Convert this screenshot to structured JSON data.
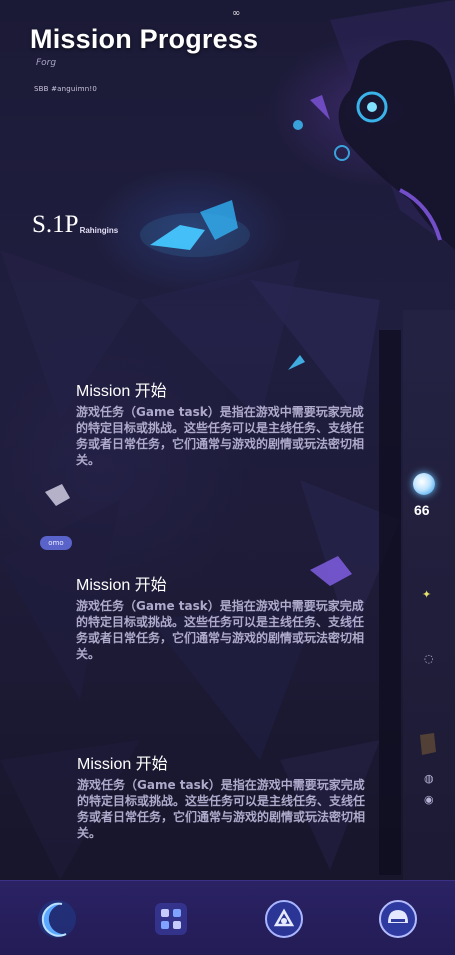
{
  "header": {
    "title": "Mission Progress",
    "top_marker": "∞",
    "subtitle": "Forg",
    "caption": "SBB #anguimn!0"
  },
  "stat": {
    "value": "S.1P",
    "unit": "Rahingins"
  },
  "chip": {
    "label": "omo"
  },
  "missions": [
    {
      "title": "Mission 开始",
      "description": "游戏任务（Game task）是指在游戏中需要玩家完成的特定目标或挑战。这些任务可以是主线任务、支线任务或者日常任务，它们通常与游戏的剧情或玩法密切相关。"
    },
    {
      "title": "Mission 开始",
      "description": "游戏任务（Game task）是指在游戏中需要玩家完成的特定目标或挑战。这些任务可以是主线任务、支线任务或者日常任务，它们通常与游戏的剧情或玩法密切相关。"
    },
    {
      "title": "Mission 开始",
      "description": "游戏任务（Game task）是指在游戏中需要玩家完成的特定目标或挑战。这些任务可以是主线任务、支线任务或者日常任务，它们通常与游戏的剧情或玩法密切相关。"
    }
  ],
  "side_rail": {
    "count": "66",
    "icons": [
      "orb-icon",
      "spark-icon",
      "swirl-icon",
      "lantern-icon",
      "coin-icon",
      "eye-icon"
    ]
  },
  "bottom_nav": {
    "items": [
      {
        "icon": "moon-crescent-icon"
      },
      {
        "icon": "inventory-icon"
      },
      {
        "icon": "skill-icon"
      },
      {
        "icon": "helmet-icon"
      }
    ]
  },
  "colors": {
    "background": "#1b1a36",
    "nav_background": "#2a2264",
    "accent_cyan": "#3ec3ff",
    "accent_purple": "#8a5cf0",
    "text_muted": "#aeaacb"
  }
}
